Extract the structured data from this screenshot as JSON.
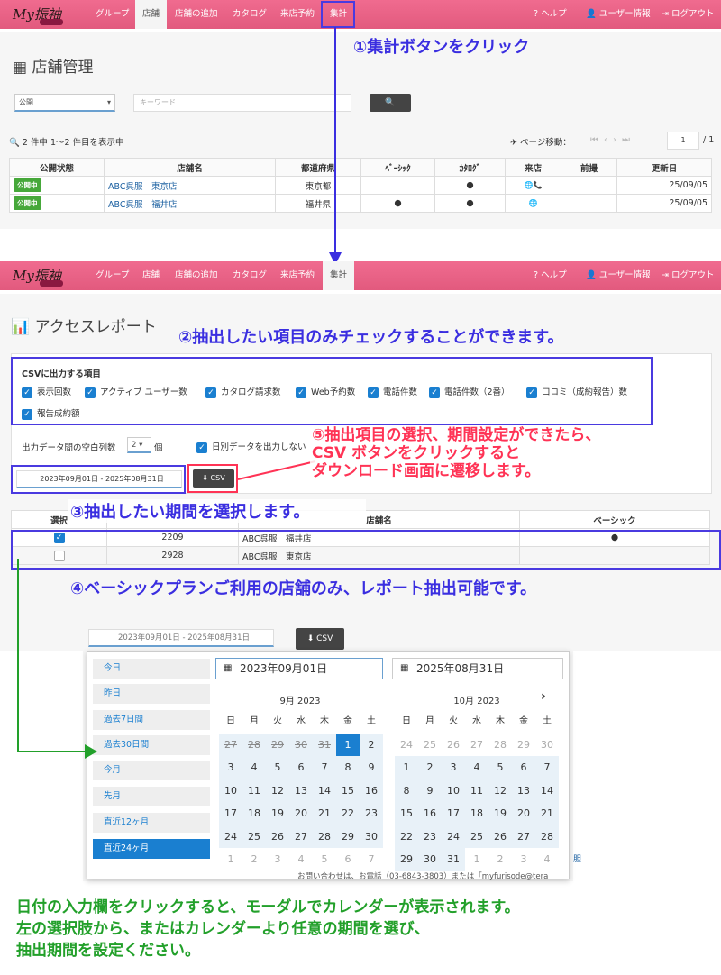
{
  "nav": {
    "logo": "My振袖",
    "items": [
      "グループ",
      "店舗",
      "店舗の追加",
      "カタログ",
      "来店予約",
      "集計"
    ],
    "help": "ヘルプ",
    "user": "ユーザー情報",
    "logout": "ログアウト"
  },
  "store": {
    "title": "店舗管理",
    "status_select": "公開",
    "keyword_placeholder": "キーワード",
    "count": "2 件中 1〜2 件目を表示中",
    "page_move": "ページ移動：",
    "page": "1",
    "page_total": "/ 1",
    "headers": [
      "公開状態",
      "店舗名",
      "都道府県",
      "ﾍﾞｰｼｯｸ",
      "ｶﾀﾛｸﾞ",
      "来店",
      "前撮",
      "更新日"
    ],
    "rows": [
      {
        "status": "公開中",
        "name": "ABC呉服　東京店",
        "pref": "東京都",
        "basic": "",
        "catalog": "●",
        "visit": "🌐📞",
        "pre": "",
        "date": "25/09/05"
      },
      {
        "status": "公開中",
        "name": "ABC呉服　福井店",
        "pref": "福井県",
        "basic": "●",
        "catalog": "●",
        "visit": "🌐",
        "pre": "",
        "date": "25/09/05"
      }
    ]
  },
  "report": {
    "title": "アクセスレポート",
    "csv_heading": "CSVに出力する項目",
    "options": [
      "表示回数",
      "アクティブ ユーザー数",
      "カタログ請求数",
      "Web予約数",
      "電話件数",
      "電話件数（2番）",
      "口コミ（成約報告）数",
      "報告成約額"
    ],
    "blank_label": "出力データ間の空白列数",
    "blank_value": "2",
    "blank_unit": "個",
    "daily_label": "日別データを出力しない",
    "date_range": "2023年09月01日 - 2025年08月31日",
    "csv_button": "CSV",
    "headers": [
      "選択",
      "",
      "店舗名",
      "ベーシック"
    ],
    "rows": [
      {
        "checked": true,
        "id": "2209",
        "name": "ABC呉服　福井店",
        "basic": "●"
      },
      {
        "checked": false,
        "id": "2928",
        "name": "ABC呉服　東京店",
        "basic": ""
      }
    ]
  },
  "picker": {
    "date_range": "2023年09月01日 - 2025年08月31日",
    "csv_button": "CSV",
    "ranges": [
      "今日",
      "昨日",
      "過去7日間",
      "過去30日間",
      "今月",
      "先月",
      "直近12ヶ月",
      "直近24ヶ月"
    ],
    "start": "2023年09月01日",
    "end": "2025年08月31日",
    "left_month": "9月 2023",
    "right_month": "10月 2023",
    "weekdays": [
      "日",
      "月",
      "火",
      "水",
      "木",
      "金",
      "土"
    ],
    "footer": "お問い合わせは、お電話（03-6843-3803）または「myfurisode@tera"
  },
  "annotations": {
    "a1": "①集計ボタンをクリック",
    "a2": "②抽出したい項目のみチェックすることができます。",
    "a3": "③抽出したい期間を選択します。",
    "a4": "④ベーシックプランご利用の店舗のみ、レポート抽出可能です。",
    "a5_1": "⑤抽出項目の選択、期間設定ができたら、",
    "a5_2": "CSV ボタンをクリックすると",
    "a5_3": "ダウンロード画面に遷移します。",
    "g1": "日付の入力欄をクリックすると、モーダルでカレンダーが表示されます。",
    "g2": "左の選択肢から、またはカレンダーより任意の期間を選び、",
    "g3": "抽出期間を設定ください。"
  },
  "colors": {
    "nav": "#e25a7e",
    "accent": "#1a7fd0",
    "annotation": "#3a2ee0",
    "red": "#ff3355",
    "green": "#22a02a"
  }
}
